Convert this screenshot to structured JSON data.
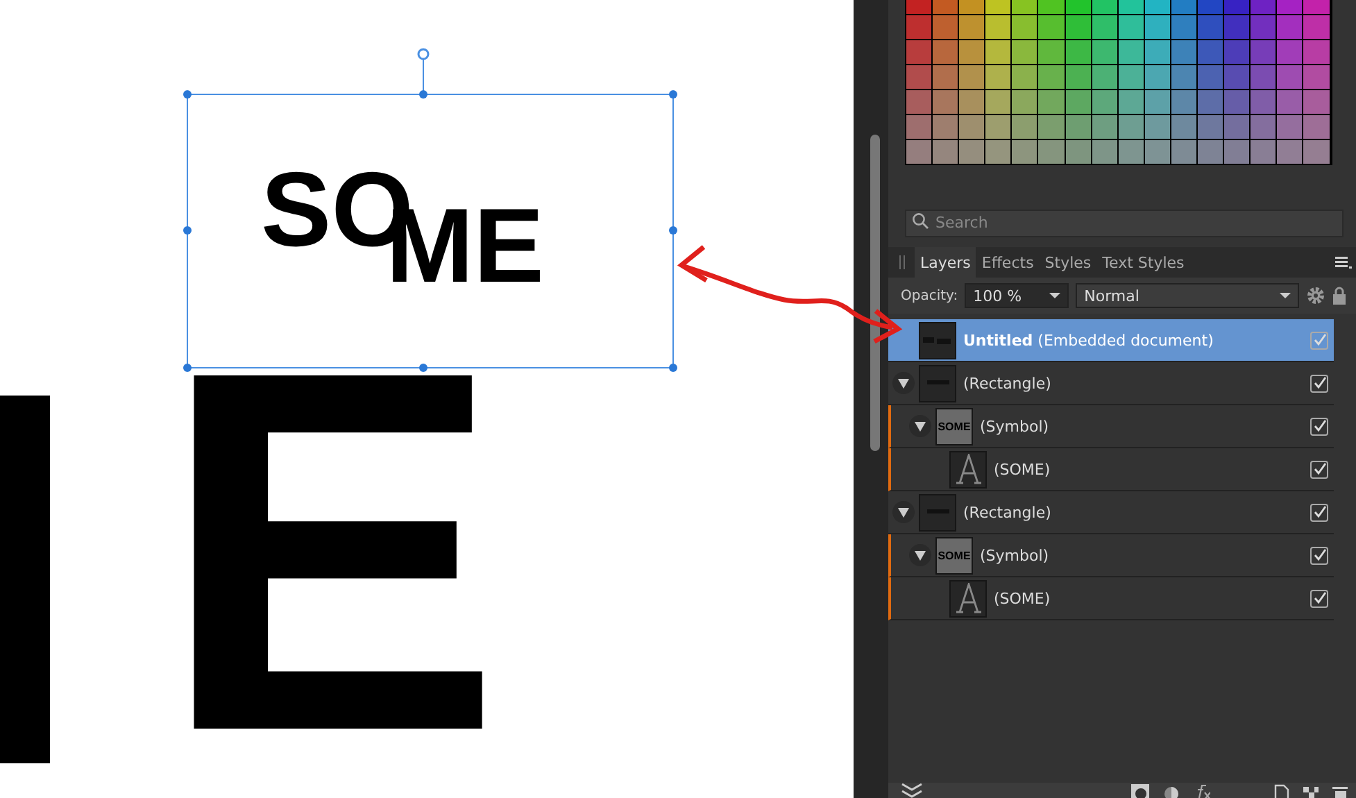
{
  "canvas": {
    "artwork_upper": "SO",
    "artwork_lower": "ME",
    "large_text": "E"
  },
  "search": {
    "placeholder": "Search"
  },
  "tabs": [
    {
      "label": "Layers",
      "selected": true
    },
    {
      "label": "Effects",
      "selected": false
    },
    {
      "label": "Styles",
      "selected": false
    },
    {
      "label": "Text Styles",
      "selected": false
    }
  ],
  "opacity": {
    "label": "Opacity:",
    "value": "100 %"
  },
  "blend_mode": {
    "value": "Normal"
  },
  "layers": [
    {
      "name": "**Untitled** (Embedded document)",
      "kind": "document",
      "selected": true,
      "visible": true
    },
    {
      "name": "(Rectangle)",
      "kind": "rectangle",
      "selected": false,
      "visible": true,
      "expanded": true,
      "children": [
        {
          "name": "(Symbol)",
          "kind": "symbol",
          "thumb_text": "SOME",
          "selected": false,
          "visible": true,
          "expanded": true,
          "children": [
            {
              "name": "(SOME)",
              "kind": "text",
              "selected": false,
              "visible": true
            }
          ]
        }
      ]
    },
    {
      "name": "(Rectangle)",
      "kind": "rectangle",
      "selected": false,
      "visible": true,
      "expanded": true,
      "children": [
        {
          "name": "(Symbol)",
          "kind": "symbol",
          "thumb_text": "SOME",
          "selected": false,
          "visible": true,
          "expanded": true,
          "children": [
            {
              "name": "(SOME)",
              "kind": "text",
              "selected": false,
              "visible": true
            }
          ]
        }
      ]
    }
  ]
}
